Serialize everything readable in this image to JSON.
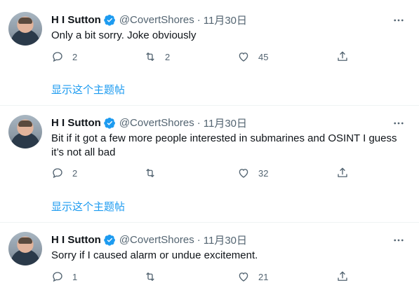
{
  "tweets": [
    {
      "name": "H I Sutton",
      "handle": "@CovertShores",
      "separator": "·",
      "date": "11月30日",
      "lines": [
        "Only a bit sorry. Joke obviously"
      ],
      "replies": "2",
      "retweets": "2",
      "likes": "45",
      "thread_link": "显示这个主题帖"
    },
    {
      "name": "H I Sutton",
      "handle": "@CovertShores",
      "separator": "·",
      "date": "11月30日",
      "lines": [
        "Bit if it got a few more people interested in submarines and OSINT I guess",
        "it’s not all bad"
      ],
      "replies": "2",
      "retweets": "",
      "likes": "32",
      "thread_link": "显示这个主题帖"
    },
    {
      "name": "H I Sutton",
      "handle": "@CovertShores",
      "separator": "·",
      "date": "11月30日",
      "lines": [
        "Sorry if I caused alarm or undue excitement."
      ],
      "replies": "1",
      "retweets": "",
      "likes": "21",
      "thread_link": ""
    }
  ],
  "colors": {
    "accent": "#1d9bf0",
    "text": "#0f1419",
    "secondary": "#536471",
    "divider": "#eff3f4"
  },
  "icons": [
    "verified-badge-icon",
    "more-options-icon",
    "reply-icon",
    "retweet-icon",
    "like-icon",
    "share-icon"
  ]
}
